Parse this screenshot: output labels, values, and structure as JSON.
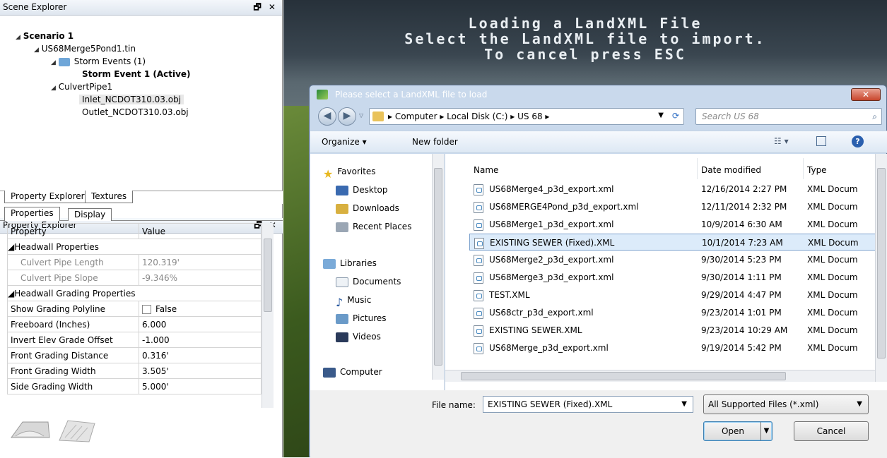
{
  "scene_explorer": {
    "title": "Scene Explorer",
    "window_controls": "🗗 ✕",
    "tree": {
      "scenario": "Scenario 1",
      "tin": "US68Merge5Pond1.tin",
      "storm_events": "Storm Events (1)",
      "storm_event_active": "Storm Event 1 (Active)",
      "culvert": "CulvertPipe1",
      "inlet": "Inlet_NCDOT310.03.obj",
      "outlet": "Outlet_NCDOT310.03.obj"
    }
  },
  "lower_tabs": [
    "Property Explorer",
    "Textures"
  ],
  "property_explorer": {
    "title": "Property Explorer",
    "tabs": [
      "Properties",
      "Display"
    ],
    "columns": [
      "Property",
      "Value"
    ],
    "groups": [
      {
        "name": "Headwall Properties",
        "rows": [
          {
            "property": "Culvert Pipe Length",
            "value": "120.319'"
          },
          {
            "property": "Culvert Pipe Slope",
            "value": "-9.346%"
          }
        ]
      },
      {
        "name": "Headwall Grading Properties",
        "rows": [
          {
            "property": "Show Grading Polyline",
            "value": "False"
          },
          {
            "property": "Freeboard (Inches)",
            "value": "6.000"
          },
          {
            "property": "Invert Elev Grade Offset",
            "value": "-1.000"
          },
          {
            "property": "Front Grading Distance",
            "value": "0.316'"
          },
          {
            "property": "Front Grading Width",
            "value": "3.505'"
          },
          {
            "property": "Side Grading Width",
            "value": "5.000'"
          }
        ]
      }
    ]
  },
  "overlay": {
    "line1": "Loading a LandXML File",
    "line2": "Select the LandXML file to import.",
    "line3": "To cancel press ESC"
  },
  "dialog": {
    "title": "Please select a LandXML file to load",
    "close": "✕",
    "breadcrumb": [
      "Computer",
      "Local Disk (C:)",
      "US 68"
    ],
    "search_placeholder": "Search US 68",
    "organize": "Organize ▾",
    "new_folder": "New folder",
    "nav": {
      "favorites": "Favorites",
      "desktop": "Desktop",
      "downloads": "Downloads",
      "recent": "Recent Places",
      "libraries": "Libraries",
      "documents": "Documents",
      "music": "Music",
      "pictures": "Pictures",
      "videos": "Videos",
      "computer": "Computer"
    },
    "columns": {
      "name": "Name",
      "date": "Date modified",
      "type": "Type"
    },
    "files": [
      {
        "name": "US68Merge4_p3d_export.xml",
        "date": "12/16/2014 2:27 PM",
        "type": "XML Docum"
      },
      {
        "name": "US68MERGE4Pond_p3d_export.xml",
        "date": "12/11/2014 2:32 PM",
        "type": "XML Docum"
      },
      {
        "name": "US68Merge1_p3d_export.xml",
        "date": "10/9/2014 6:30 AM",
        "type": "XML Docum"
      },
      {
        "name": "EXISTING SEWER (Fixed).XML",
        "date": "10/1/2014 7:23 AM",
        "type": "XML Docum"
      },
      {
        "name": "US68Merge2_p3d_export.xml",
        "date": "9/30/2014 5:23 PM",
        "type": "XML Docum"
      },
      {
        "name": "US68Merge3_p3d_export.xml",
        "date": "9/30/2014 1:11 PM",
        "type": "XML Docum"
      },
      {
        "name": "TEST.XML",
        "date": "9/29/2014 4:47 PM",
        "type": "XML Docum"
      },
      {
        "name": "US68ctr_p3d_export.xml",
        "date": "9/23/2014 1:01 PM",
        "type": "XML Docum"
      },
      {
        "name": "EXISTING SEWER.XML",
        "date": "9/23/2014 10:29 AM",
        "type": "XML Docum"
      },
      {
        "name": "US68Merge_p3d_export.xml",
        "date": "9/19/2014 5:42 PM",
        "type": "XML Docum"
      }
    ],
    "file_name_label": "File name:",
    "file_name_value": "EXISTING SEWER (Fixed).XML",
    "filter": "All Supported Files (*.xml)",
    "open": "Open",
    "cancel": "Cancel"
  }
}
